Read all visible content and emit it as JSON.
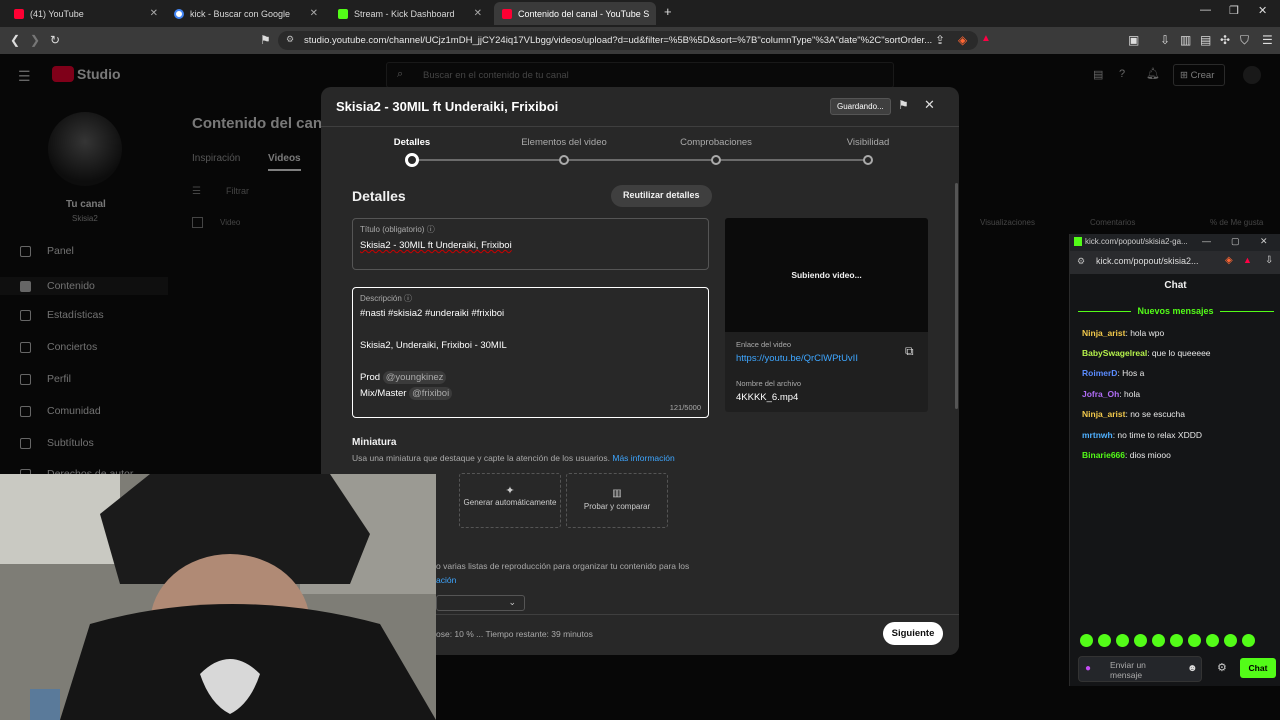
{
  "browser": {
    "tabs": [
      {
        "label": "(41) YouTube",
        "color": "#ff0033"
      },
      {
        "label": "kick - Buscar con Google",
        "color": "#4285f4"
      },
      {
        "label": "Stream - Kick Dashboard",
        "color": "#53fc18"
      },
      {
        "label": "Contenido del canal - YouTube S",
        "color": "#ff0033"
      }
    ],
    "new_tab": "+",
    "url": "studio.youtube.com/channel/UCjz1mDH_jjCY24iq17VLbgg/videos/upload?d=ud&filter=%5B%5D&sort=%7B\"columnType\"%3A\"date\"%2C\"sortOrder..."
  },
  "studio": {
    "logo": "Studio",
    "search_placeholder": "Buscar en el contenido de tu canal",
    "create_label": "Crear",
    "channel_label": "Tu canal",
    "channel_handle": "Skisia2",
    "page_title": "Contenido del canal",
    "tabs": [
      "Inspiración",
      "Videos"
    ],
    "filter_placeholder": "Filtrar",
    "col_video": "Video",
    "col_views": "Visualizaciones",
    "col_comments": "Comentarios",
    "col_likes": "% de Me gusta",
    "sidebar": [
      "Panel",
      "Contenido",
      "Estadísticas",
      "Conciertos",
      "Perfil",
      "Comunidad",
      "Subtítulos",
      "Derechos de autor"
    ]
  },
  "modal": {
    "title": "Skisia2 - 30MIL ft Underaiki, Frixiboi",
    "saving": "Guardando...",
    "steps": [
      "Detalles",
      "Elementos del video",
      "Comprobaciones",
      "Visibilidad"
    ],
    "active_step": 0,
    "section_title": "Detalles",
    "reuse_button": "Reutilizar detalles",
    "title_field": {
      "label": "Título (obligatorio)",
      "value": "Skisia2 - 30MIL ft Underaiki, Frixiboi"
    },
    "description_field": {
      "label": "Descripción",
      "line1": "#nasti #skisia2 #underaiki #frixiboi",
      "line2": "Skisia2, Underaiki, Frixiboi - 30MIL",
      "prod_label": "Prod",
      "prod_handle": "@youngkinez",
      "mix_label": "Mix/Master",
      "mix_handle": "@frixiboi",
      "counter": "121/5000"
    },
    "preview": {
      "status": "Subiendo video...",
      "link_label": "Enlace del video",
      "link_value": "https://youtu.be/QrClWPtUvII",
      "file_label": "Nombre del archivo",
      "file_value": "4KKKK_6.mp4"
    },
    "thumbnail": {
      "title": "Miniatura",
      "help": "Usa una miniatura que destaque y capte la atención de los usuarios.",
      "more_info": "Más información",
      "generate": "Generar automáticamente",
      "test": "Probar y comparar"
    },
    "playlist_help": "o varias listas de reproducción para organizar tu contenido para los",
    "playlist_link": "ación",
    "footer_status": "ose: 10 % ... Tiempo restante: 39 minutos",
    "next_button": "Siguiente"
  },
  "chat": {
    "window_url": "kick.com/popout/skisia2-ga...",
    "address": "kick.com/popout/skisia2...",
    "title": "Chat",
    "new_messages": "Nuevos mensajes",
    "messages": [
      {
        "user": "Ninja_arist",
        "text": ": hola wpo",
        "color": "#f2c94c"
      },
      {
        "user": "BabySwagelreal",
        "text": ": que lo queeeee",
        "color": "#b6f24c"
      },
      {
        "user": "RoimerD",
        "text": ": Hos a",
        "color": "#5b8cff"
      },
      {
        "user": "Jofra_Oh",
        "text": ": hola",
        "color": "#b06cf5"
      },
      {
        "user": "Ninja_arist",
        "text": ": no se escucha",
        "color": "#f2c94c"
      },
      {
        "user": "mrtnwh",
        "text": ": no time to relax XDDD",
        "color": "#4fb0ff"
      },
      {
        "user": "Binarie666",
        "text": ": dios miooo",
        "color": "#53fc18"
      }
    ],
    "input_placeholder": "Enviar un mensaje",
    "send_button": "Chat",
    "accent": "#53fc18"
  }
}
